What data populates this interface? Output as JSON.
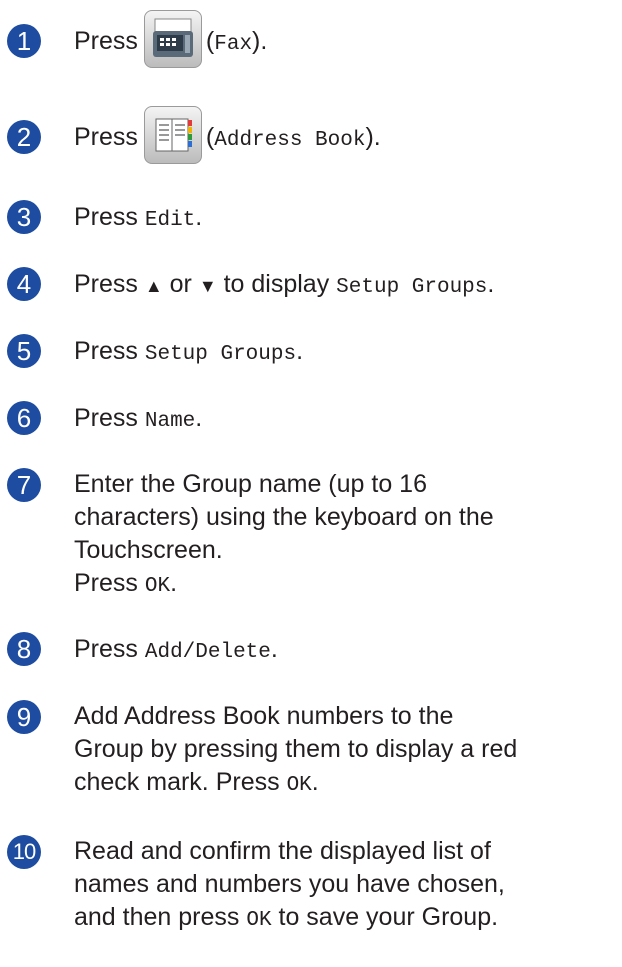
{
  "steps": [
    {
      "num": "1",
      "parts": {
        "a": "Press",
        "b": "(",
        "c": "Fax",
        "d": ")."
      },
      "icon": "fax-icon"
    },
    {
      "num": "2",
      "parts": {
        "a": "Press",
        "b": "(",
        "c": "Address Book",
        "d": ")."
      },
      "icon": "address-book-icon"
    },
    {
      "num": "3",
      "parts": {
        "a": "Press ",
        "c": "Edit",
        "d": "."
      }
    },
    {
      "num": "4",
      "parts": {
        "a": "Press ",
        "up": "▲",
        "or": " or ",
        "down": "▼",
        "mid": " to display ",
        "c": "Setup Groups",
        "d": "."
      }
    },
    {
      "num": "5",
      "parts": {
        "a": "Press ",
        "c": "Setup Groups",
        "d": "."
      }
    },
    {
      "num": "6",
      "parts": {
        "a": "Press ",
        "c": "Name",
        "d": "."
      }
    },
    {
      "num": "7",
      "line1": "Enter the Group name (up to 16",
      "line2": "characters)  using the keyboard on the",
      "line3": "Touchscreen.",
      "press": "Press ",
      "c": "OK",
      "d": "."
    },
    {
      "num": "8",
      "parts": {
        "a": "Press ",
        "c": "Add/Delete",
        "d": "."
      }
    },
    {
      "num": "9",
      "line1": "Add Address Book numbers to the",
      "line2": "Group by pressing them to display a red",
      "line3": "check mark. Press ",
      "c": "OK",
      "d": "."
    },
    {
      "num": "10",
      "line1": "Read and confirm the displayed list of",
      "line2": "names and numbers you have chosen,",
      "line3a": "and then press ",
      "c": "OK",
      "line3b": " to save your Group."
    }
  ]
}
